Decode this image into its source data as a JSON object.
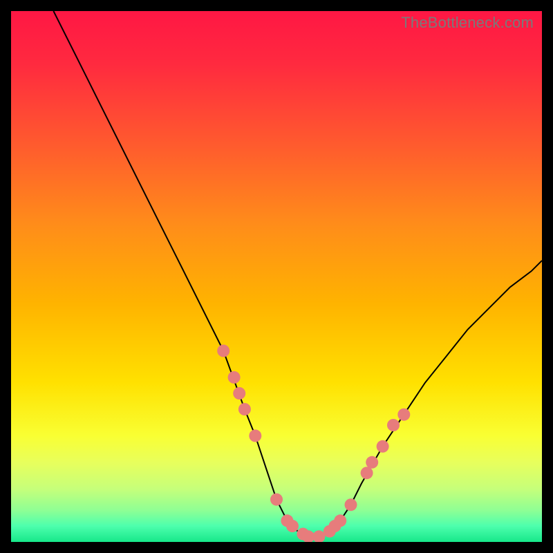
{
  "attribution": "TheBottleneck.com",
  "chart_data": {
    "type": "line",
    "title": "",
    "xlabel": "",
    "ylabel": "",
    "xlim": [
      0,
      100
    ],
    "ylim": [
      0,
      100
    ],
    "series": [
      {
        "name": "bottleneck-curve",
        "x": [
          8,
          12,
          16,
          20,
          24,
          28,
          32,
          36,
          40,
          44,
          46,
          48,
          50,
          52,
          54,
          56,
          58,
          60,
          62,
          64,
          66,
          70,
          74,
          78,
          82,
          86,
          90,
          94,
          98,
          100
        ],
        "y": [
          100,
          92,
          84,
          76,
          68,
          60,
          52,
          44,
          36,
          25,
          20,
          14,
          8,
          4,
          2,
          1,
          1,
          2,
          4,
          7,
          11,
          18,
          24,
          30,
          35,
          40,
          44,
          48,
          51,
          53
        ]
      }
    ],
    "markers": {
      "name": "highlight-dots",
      "color": "#e77c7c",
      "points": [
        {
          "x": 40,
          "y": 36
        },
        {
          "x": 42,
          "y": 31
        },
        {
          "x": 43,
          "y": 28
        },
        {
          "x": 44,
          "y": 25
        },
        {
          "x": 46,
          "y": 20
        },
        {
          "x": 50,
          "y": 8
        },
        {
          "x": 52,
          "y": 4
        },
        {
          "x": 53,
          "y": 3
        },
        {
          "x": 55,
          "y": 1.5
        },
        {
          "x": 56,
          "y": 1
        },
        {
          "x": 58,
          "y": 1
        },
        {
          "x": 60,
          "y": 2
        },
        {
          "x": 61,
          "y": 3
        },
        {
          "x": 62,
          "y": 4
        },
        {
          "x": 64,
          "y": 7
        },
        {
          "x": 67,
          "y": 13
        },
        {
          "x": 68,
          "y": 15
        },
        {
          "x": 70,
          "y": 18
        },
        {
          "x": 72,
          "y": 22
        },
        {
          "x": 74,
          "y": 24
        }
      ]
    },
    "background_gradient": {
      "stops": [
        {
          "offset": 0.0,
          "color": "#ff1744"
        },
        {
          "offset": 0.1,
          "color": "#ff2a3f"
        },
        {
          "offset": 0.25,
          "color": "#ff5a2e"
        },
        {
          "offset": 0.4,
          "color": "#ff8c1a"
        },
        {
          "offset": 0.55,
          "color": "#ffb300"
        },
        {
          "offset": 0.7,
          "color": "#ffe100"
        },
        {
          "offset": 0.8,
          "color": "#f9ff33"
        },
        {
          "offset": 0.85,
          "color": "#e8ff5c"
        },
        {
          "offset": 0.9,
          "color": "#c6ff7a"
        },
        {
          "offset": 0.94,
          "color": "#8fff94"
        },
        {
          "offset": 0.97,
          "color": "#4dffad"
        },
        {
          "offset": 1.0,
          "color": "#17e88a"
        }
      ]
    }
  }
}
